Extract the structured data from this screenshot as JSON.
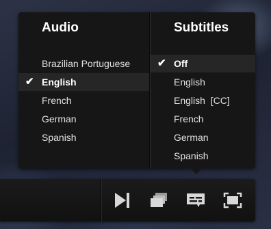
{
  "audio": {
    "heading": "Audio",
    "items": [
      {
        "label": "Brazilian Portuguese",
        "selected": false
      },
      {
        "label": "English",
        "selected": true
      },
      {
        "label": "French",
        "selected": false
      },
      {
        "label": "German",
        "selected": false
      },
      {
        "label": "Spanish",
        "selected": false
      }
    ]
  },
  "subtitles": {
    "heading": "Subtitles",
    "items": [
      {
        "label": "Off",
        "selected": true
      },
      {
        "label": "English",
        "selected": false
      },
      {
        "label": "English  [CC]",
        "selected": false
      },
      {
        "label": "French",
        "selected": false
      },
      {
        "label": "German",
        "selected": false
      },
      {
        "label": "Spanish",
        "selected": false
      }
    ]
  },
  "check_glyph": "✔",
  "controls": {
    "icons": [
      "next-episode-icon",
      "episodes-icon",
      "subtitles-icon",
      "fullscreen-icon"
    ]
  },
  "colors": {
    "panel_bg": "#161616",
    "selected_row_bg": "#262626",
    "icon_color": "#d8d8d8"
  }
}
